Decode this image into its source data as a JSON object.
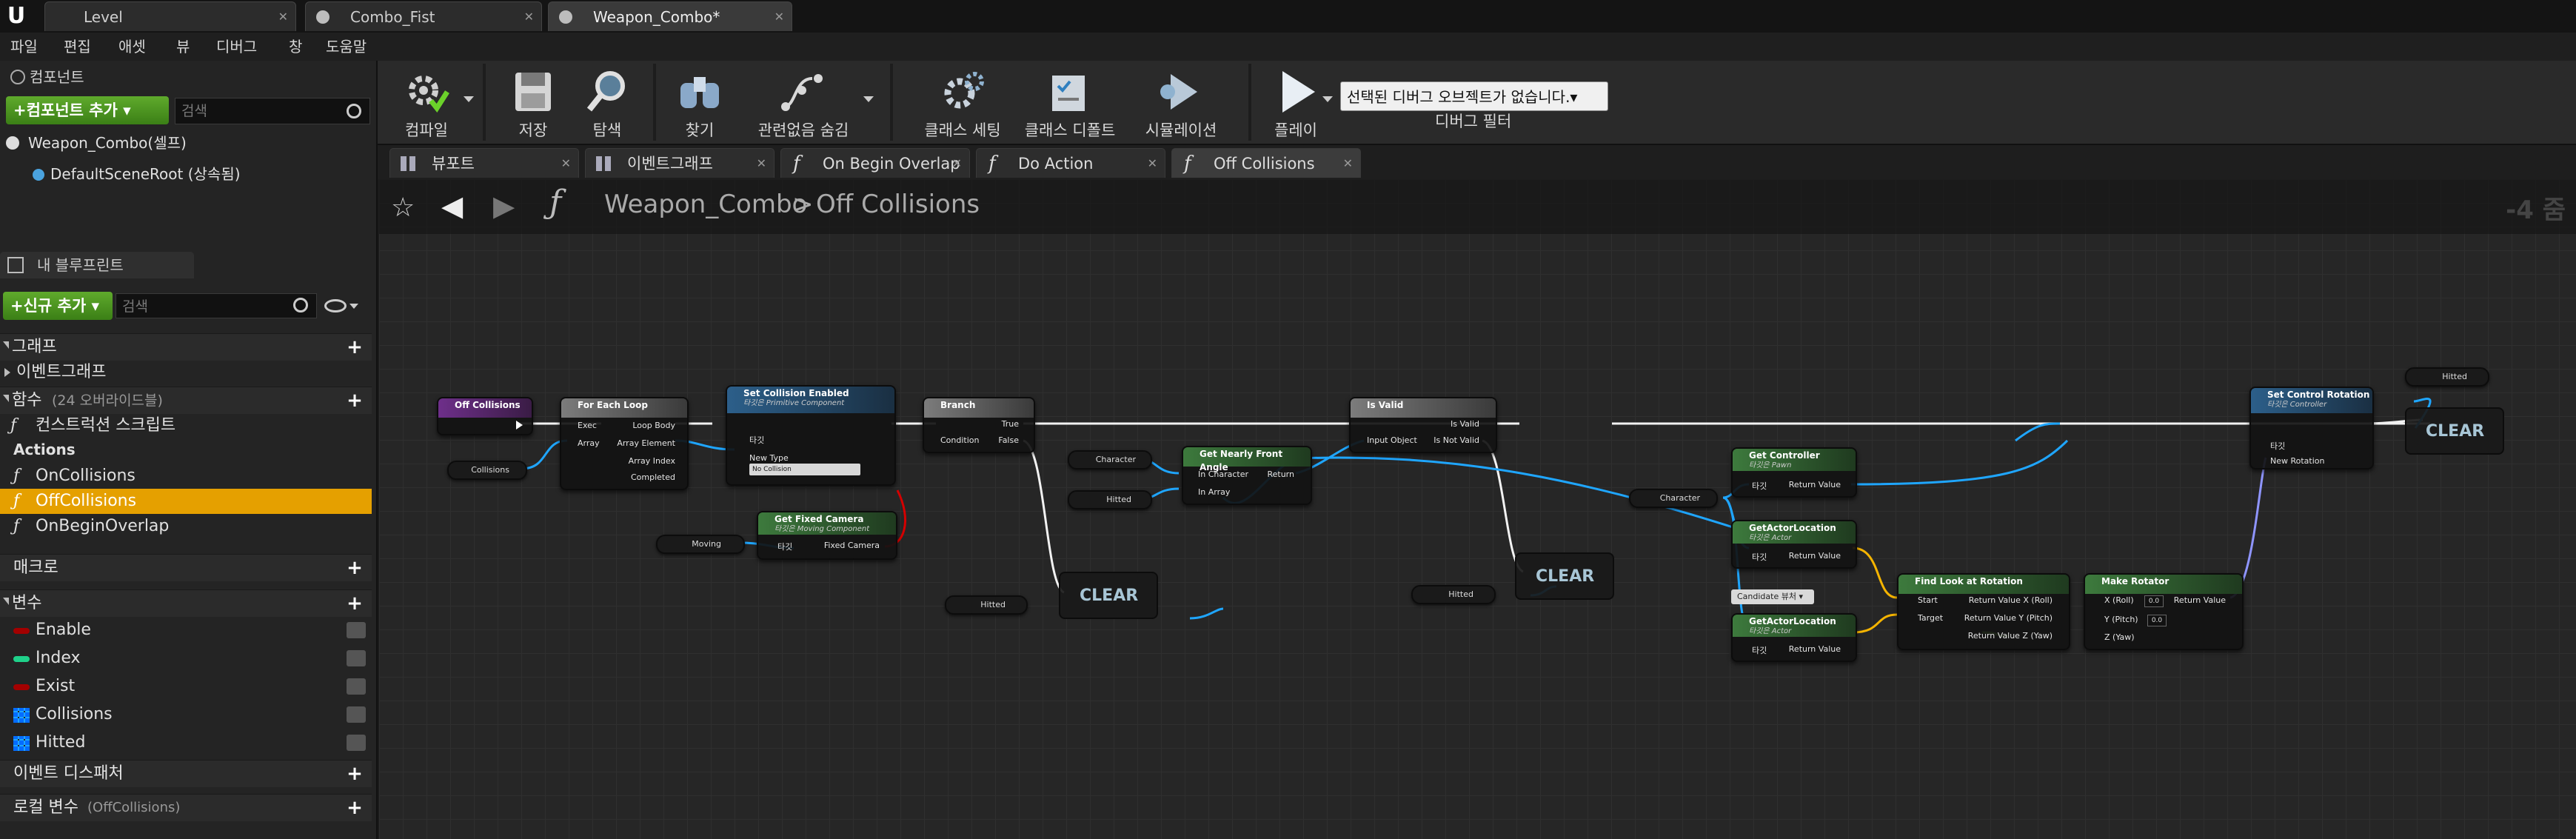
{
  "app": {
    "logo": "U",
    "doc_tabs": [
      {
        "label": "Level"
      },
      {
        "label": "Combo_Fist"
      },
      {
        "label": "Weapon_Combo*"
      }
    ]
  },
  "menu": [
    "파일",
    "편집",
    "애셋",
    "뷰",
    "디버그",
    "창",
    "도움말"
  ],
  "components_panel": {
    "title": "컴포넌트",
    "add_button": "+컴포넌트 추가 ▾",
    "search_placeholder": "검색",
    "items": [
      "Weapon_Combo(셀프)",
      "DefaultSceneRoot (상속됨)"
    ]
  },
  "blueprint_panel": {
    "title": "내 블루프린트",
    "new_button": "+신규 추가 ▾",
    "search_placeholder": "검색",
    "sections": {
      "graph": "그래프",
      "functions": "함수",
      "functions_note": "(24 오버라이드블)",
      "macros": "매크로",
      "variables": "변수",
      "dispatchers": "이벤트 디스패처",
      "locals": "로컬 변수",
      "locals_note": "(OffCollisions)"
    },
    "graph_items": [
      "이벤트그래프"
    ],
    "function_items": [
      "컨스트럭션 스크립트",
      "Actions",
      "OnCollisions",
      "OffCollisions",
      "OnBeginOverlap"
    ],
    "variables": [
      {
        "name": "Enable",
        "color": "#a30000"
      },
      {
        "name": "Index",
        "color": "#1fd18a"
      },
      {
        "name": "Exist",
        "color": "#a30000"
      },
      {
        "name": "Collisions",
        "color": "#1fa6ff"
      },
      {
        "name": "Hitted",
        "color": "#1fa6ff"
      }
    ]
  },
  "toolbar": {
    "buttons": [
      "컴파일",
      "저장",
      "탐색",
      "찾기",
      "관련없음 숨김",
      "클래스 세팅",
      "클래스 디폴트",
      "시뮬레이션",
      "플레이"
    ],
    "debug_select": "선택된 디버그 오브젝트가 없습니다.▾",
    "debug_label": "디버그 필터"
  },
  "graph_tabs": [
    {
      "icon": "grid-icon",
      "label": "뷰포트"
    },
    {
      "icon": "grid-icon",
      "label": "이벤트그래프"
    },
    {
      "icon": "f",
      "label": "On Begin Overlap"
    },
    {
      "icon": "f",
      "label": "Do Action"
    },
    {
      "icon": "f",
      "label": "Off Collisions"
    }
  ],
  "breadcrumb": {
    "root": "Weapon_Combo",
    "sep": ">",
    "current": "Off Collisions"
  },
  "zoom": "-4 줌",
  "nodes": {
    "off_collisions": {
      "title": "Off Collisions"
    },
    "for_each": {
      "title": "For Each Loop",
      "pins": [
        "Exec",
        "Array",
        "Loop Body",
        "Array Element",
        "Array Index",
        "Completed"
      ]
    },
    "set_collision": {
      "title": "Set Collision Enabled",
      "sub": "타깃은 Primitive Component",
      "pins": [
        "타깃",
        "New Type"
      ],
      "dropdown": "No Collision"
    },
    "get_fixed_camera": {
      "title": "Get Fixed Camera",
      "sub": "타깃은 Moving Component",
      "pins": [
        "타깃",
        "Fixed Camera"
      ]
    },
    "branch": {
      "title": "Branch",
      "pins": [
        "Condition",
        "True",
        "False"
      ]
    },
    "nearly_front": {
      "title": "Get Nearly Front Angle",
      "pins": [
        "In Character",
        "In Array",
        "Return"
      ]
    },
    "is_valid": {
      "title": "Is Valid",
      "pins": [
        "Input Object",
        "Is Valid",
        "Is Not Valid"
      ]
    },
    "get_controller": {
      "title": "Get Controller",
      "sub": "타깃은 Pawn",
      "pins": [
        "타깃",
        "Return Value"
      ]
    },
    "get_actor_loc1": {
      "title": "GetActorLocation",
      "sub": "타깃은 Actor",
      "pins": [
        "타깃",
        "Return Value"
      ]
    },
    "get_actor_loc2": {
      "title": "GetActorLocation",
      "sub": "타깃은 Actor",
      "pins": [
        "타깃",
        "Return Value"
      ]
    },
    "find_look": {
      "title": "Find Look at Rotation",
      "pins": [
        "Start",
        "Target",
        "Return Value X (Roll)",
        "Return Value Y (Pitch)",
        "Return Value Z (Yaw)"
      ]
    },
    "make_rotator": {
      "title": "Make Rotator",
      "pins": [
        "X (Roll)",
        "Y (Pitch)",
        "Z (Yaw)",
        "Return Value"
      ],
      "x": "0.0",
      "y": "0.0"
    },
    "set_control_rot": {
      "title": "Set Control Rotation",
      "sub": "타깃은 Controller",
      "pins": [
        "타깃",
        "New Rotation"
      ]
    },
    "candidate": "Candidate 뷰처 ▾",
    "clear_label": "CLEAR",
    "vars": {
      "collisions": "Collisions",
      "moving": "Moving",
      "character": "Character",
      "hitted": "Hitted"
    }
  }
}
